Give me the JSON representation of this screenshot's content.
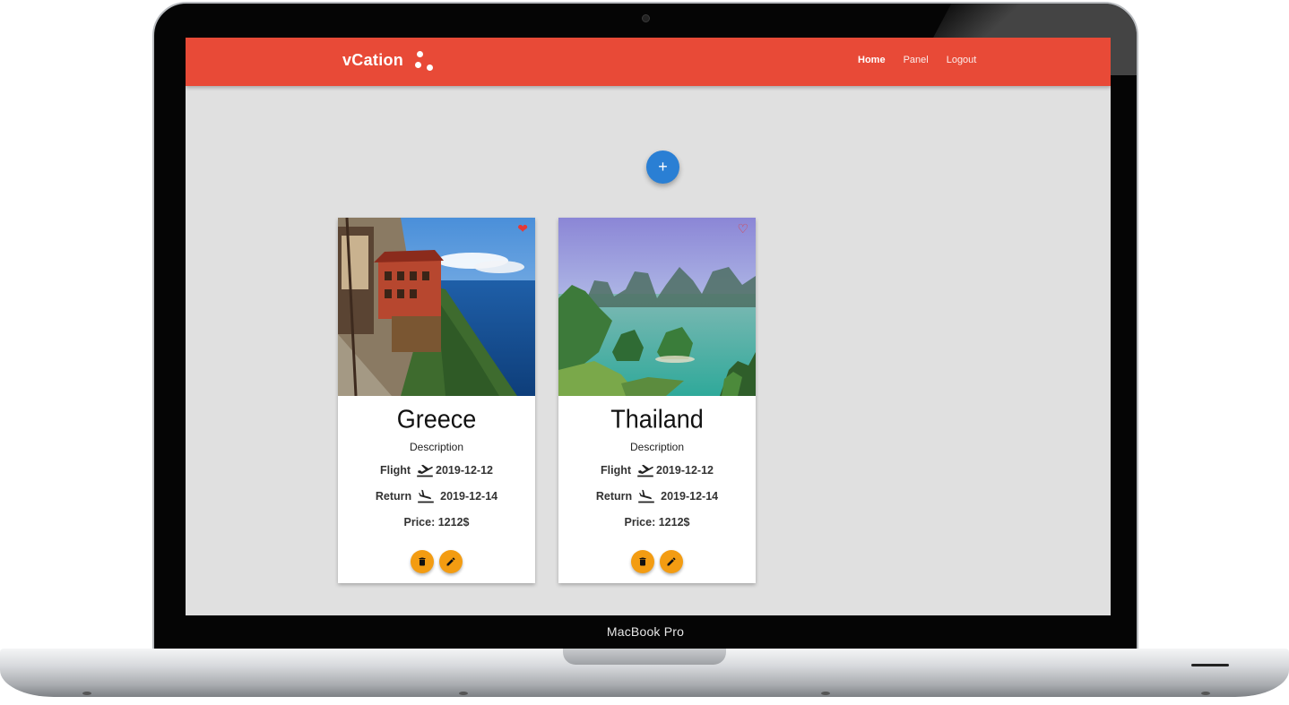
{
  "device": {
    "brand_label": "MacBook Pro"
  },
  "navbar": {
    "logo": "vCation",
    "links": [
      {
        "label": "Home",
        "active": true
      },
      {
        "label": "Panel",
        "active": false
      },
      {
        "label": "Logout",
        "active": false
      }
    ],
    "background_color": "#e84a37"
  },
  "add_button": {
    "label": "+",
    "color": "#2a7fd4"
  },
  "cards": [
    {
      "title": "Greece",
      "description": "Description",
      "flight_label": "Flight",
      "flight_date": "2019-12-12",
      "return_label": "Return",
      "return_date": "2019-12-14",
      "price_text": "Price: 1212$",
      "favorited": true,
      "image": "cliffside-monastery-sea-photo"
    },
    {
      "title": "Thailand",
      "description": "Description",
      "flight_label": "Flight",
      "flight_date": "2019-12-12",
      "return_label": "Return",
      "return_date": "2019-12-14",
      "price_text": "Price: 1212$",
      "favorited": false,
      "image": "bay-limestone-islands-photo"
    }
  ],
  "icons": {
    "heart_filled": "heart-filled-icon",
    "heart_outline": "heart-outline-icon",
    "takeoff": "flight-takeoff-icon",
    "landing": "flight-land-icon",
    "delete": "trash-icon",
    "edit": "pencil-icon"
  },
  "accent_color": "#f39c12"
}
